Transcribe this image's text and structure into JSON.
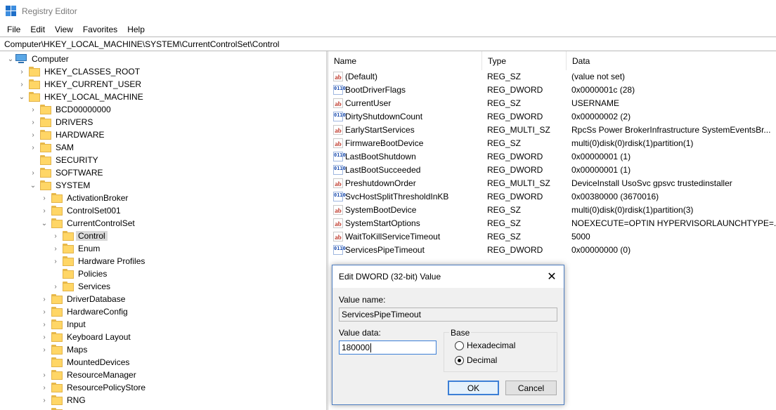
{
  "window": {
    "title": "Registry Editor"
  },
  "menu": [
    "File",
    "Edit",
    "View",
    "Favorites",
    "Help"
  ],
  "address": "Computer\\HKEY_LOCAL_MACHINE\\SYSTEM\\CurrentControlSet\\Control",
  "tree": {
    "root": "Computer",
    "hkcr": "HKEY_CLASSES_ROOT",
    "hkcu": "HKEY_CURRENT_USER",
    "hklm": "HKEY_LOCAL_MACHINE",
    "bcd": "BCD00000000",
    "drivers": "DRIVERS",
    "hardware": "HARDWARE",
    "sam": "SAM",
    "security": "SECURITY",
    "software": "SOFTWARE",
    "system": "SYSTEM",
    "activationbroker": "ActivationBroker",
    "controlset001": "ControlSet001",
    "currentcontrolset": "CurrentControlSet",
    "control": "Control",
    "enum": "Enum",
    "hardwareprofiles": "Hardware Profiles",
    "policies": "Policies",
    "services": "Services",
    "driverdatabase": "DriverDatabase",
    "hardwareconfig": "HardwareConfig",
    "input": "Input",
    "keyboardlayout": "Keyboard Layout",
    "maps": "Maps",
    "mounteddevices": "MountedDevices",
    "resourcemanager": "ResourceManager",
    "resourcepolicystore": "ResourcePolicyStore",
    "rng": "RNG"
  },
  "list": {
    "headers": {
      "name": "Name",
      "type": "Type",
      "data": "Data"
    },
    "rows": [
      {
        "icon": "string-value-icon",
        "name": "(Default)",
        "type": "REG_SZ",
        "data": "(value not set)"
      },
      {
        "icon": "binary-value-icon",
        "name": "BootDriverFlags",
        "type": "REG_DWORD",
        "data": "0x0000001c (28)"
      },
      {
        "icon": "string-value-icon",
        "name": "CurrentUser",
        "type": "REG_SZ",
        "data": "USERNAME"
      },
      {
        "icon": "binary-value-icon",
        "name": "DirtyShutdownCount",
        "type": "REG_DWORD",
        "data": "0x00000002 (2)"
      },
      {
        "icon": "string-value-icon",
        "name": "EarlyStartServices",
        "type": "REG_MULTI_SZ",
        "data": "RpcSs Power BrokerInfrastructure SystemEventsBr..."
      },
      {
        "icon": "string-value-icon",
        "name": "FirmwareBootDevice",
        "type": "REG_SZ",
        "data": "multi(0)disk(0)rdisk(1)partition(1)"
      },
      {
        "icon": "binary-value-icon",
        "name": "LastBootShutdown",
        "type": "REG_DWORD",
        "data": "0x00000001 (1)"
      },
      {
        "icon": "binary-value-icon",
        "name": "LastBootSucceeded",
        "type": "REG_DWORD",
        "data": "0x00000001 (1)"
      },
      {
        "icon": "string-value-icon",
        "name": "PreshutdownOrder",
        "type": "REG_MULTI_SZ",
        "data": "DeviceInstall UsoSvc gpsvc trustedinstaller"
      },
      {
        "icon": "binary-value-icon",
        "name": "SvcHostSplitThresholdInKB",
        "type": "REG_DWORD",
        "data": "0x00380000 (3670016)"
      },
      {
        "icon": "string-value-icon",
        "name": "SystemBootDevice",
        "type": "REG_SZ",
        "data": "multi(0)disk(0)rdisk(1)partition(3)"
      },
      {
        "icon": "string-value-icon",
        "name": "SystemStartOptions",
        "type": "REG_SZ",
        "data": " NOEXECUTE=OPTIN  HYPERVISORLAUNCHTYPE=..."
      },
      {
        "icon": "string-value-icon",
        "name": "WaitToKillServiceTimeout",
        "type": "REG_SZ",
        "data": "5000"
      },
      {
        "icon": "binary-value-icon",
        "name": "ServicesPipeTimeout",
        "type": "REG_DWORD",
        "data": "0x00000000 (0)"
      }
    ]
  },
  "dialog": {
    "title": "Edit DWORD (32-bit) Value",
    "close_glyph": "✕",
    "value_name_label": "Value name:",
    "value_name": "ServicesPipeTimeout",
    "value_data_label": "Value data:",
    "value_data": "180000",
    "base_label": "Base",
    "hex_label": "Hexadecimal",
    "dec_label": "Decimal",
    "selected_base": "Decimal",
    "ok": "OK",
    "cancel": "Cancel"
  }
}
